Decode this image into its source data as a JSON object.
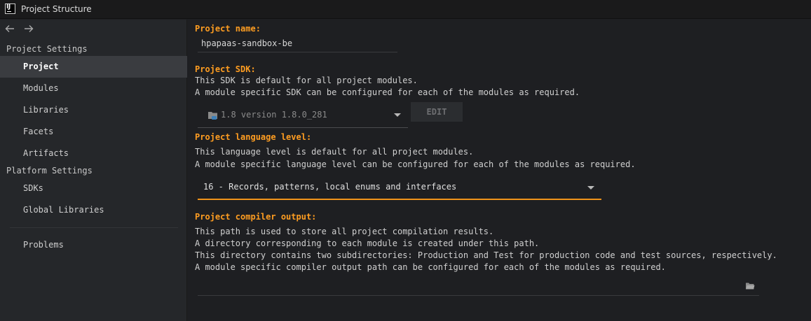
{
  "window": {
    "title": "Project Structure",
    "app_icon_text": "IJ"
  },
  "sidebar": {
    "sections": [
      {
        "title": "Project Settings"
      },
      {
        "title": "Platform Settings"
      }
    ],
    "items": [
      {
        "label": "Project",
        "selected": true
      },
      {
        "label": "Modules"
      },
      {
        "label": "Libraries"
      },
      {
        "label": "Facets"
      },
      {
        "label": "Artifacts"
      },
      {
        "label": "SDKs"
      },
      {
        "label": "Global Libraries"
      },
      {
        "label": "Problems"
      }
    ]
  },
  "project_name": {
    "label": "Project name:",
    "value": "hpapaas-sandbox-be"
  },
  "project_sdk": {
    "label": "Project SDK:",
    "desc_line1": "This SDK is default for all project modules.",
    "desc_line2": "A module specific SDK can be configured for each of the modules as required.",
    "selected": "1.8 version 1.8.0_281",
    "edit_button": "EDIT"
  },
  "language_level": {
    "label": "Project language level:",
    "desc_line1": "This language level is default for all project modules.",
    "desc_line2": "A module specific language level can be configured for each of the modules as required.",
    "selected": "16 - Records, patterns, local enums and interfaces"
  },
  "compiler_output": {
    "label": "Project compiler output:",
    "desc_line1": "This path is used to store all project compilation results.",
    "desc_line2": "A directory corresponding to each module is created under this path.",
    "desc_line3": "This directory contains two subdirectories: Production and Test for production code and test sources, respectively.",
    "desc_line4": "A module specific compiler output path can be configured for each of the modules as required.",
    "value": ""
  },
  "colors": {
    "accent": "#ff9d21",
    "selection": "#3a3c40",
    "sidebar_bg": "#25272a",
    "main_bg": "#1e1f22"
  }
}
